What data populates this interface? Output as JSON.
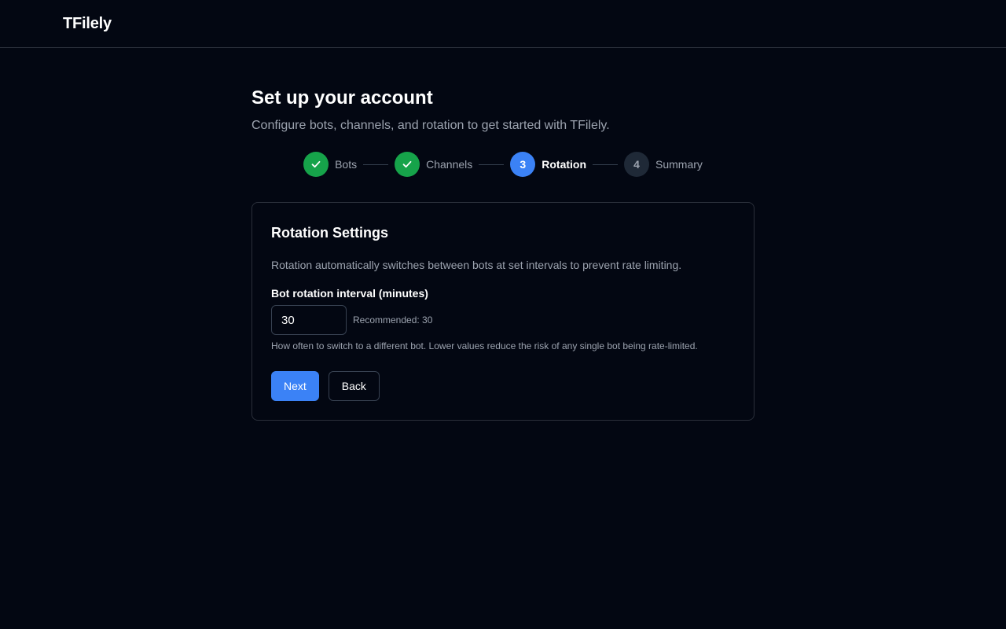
{
  "header": {
    "brand": "TFilely"
  },
  "page": {
    "title": "Set up your account",
    "subtitle": "Configure bots, channels, and rotation to get started with TFilely."
  },
  "stepper": {
    "steps": [
      {
        "label": "Bots",
        "number": "1",
        "state": "done"
      },
      {
        "label": "Channels",
        "number": "2",
        "state": "done"
      },
      {
        "label": "Rotation",
        "number": "3",
        "state": "active"
      },
      {
        "label": "Summary",
        "number": "4",
        "state": "todo"
      }
    ],
    "done_icon": "check-icon"
  },
  "card": {
    "title": "Rotation Settings",
    "description": "Rotation automatically switches between bots at set intervals to prevent rate limiting.",
    "field_label": "Bot rotation interval (minutes)",
    "interval_value": "30",
    "recommended": "Recommended: 30",
    "help_text": "How often to switch to a different bot. Lower values reduce the risk of any single bot being rate-limited."
  },
  "actions": {
    "next_label": "Next",
    "back_label": "Back"
  },
  "colors": {
    "background": "#030712",
    "accent": "#3b82f6",
    "success": "#16a34a",
    "muted_text": "#9ca3af",
    "border": "#2a2f3a"
  }
}
